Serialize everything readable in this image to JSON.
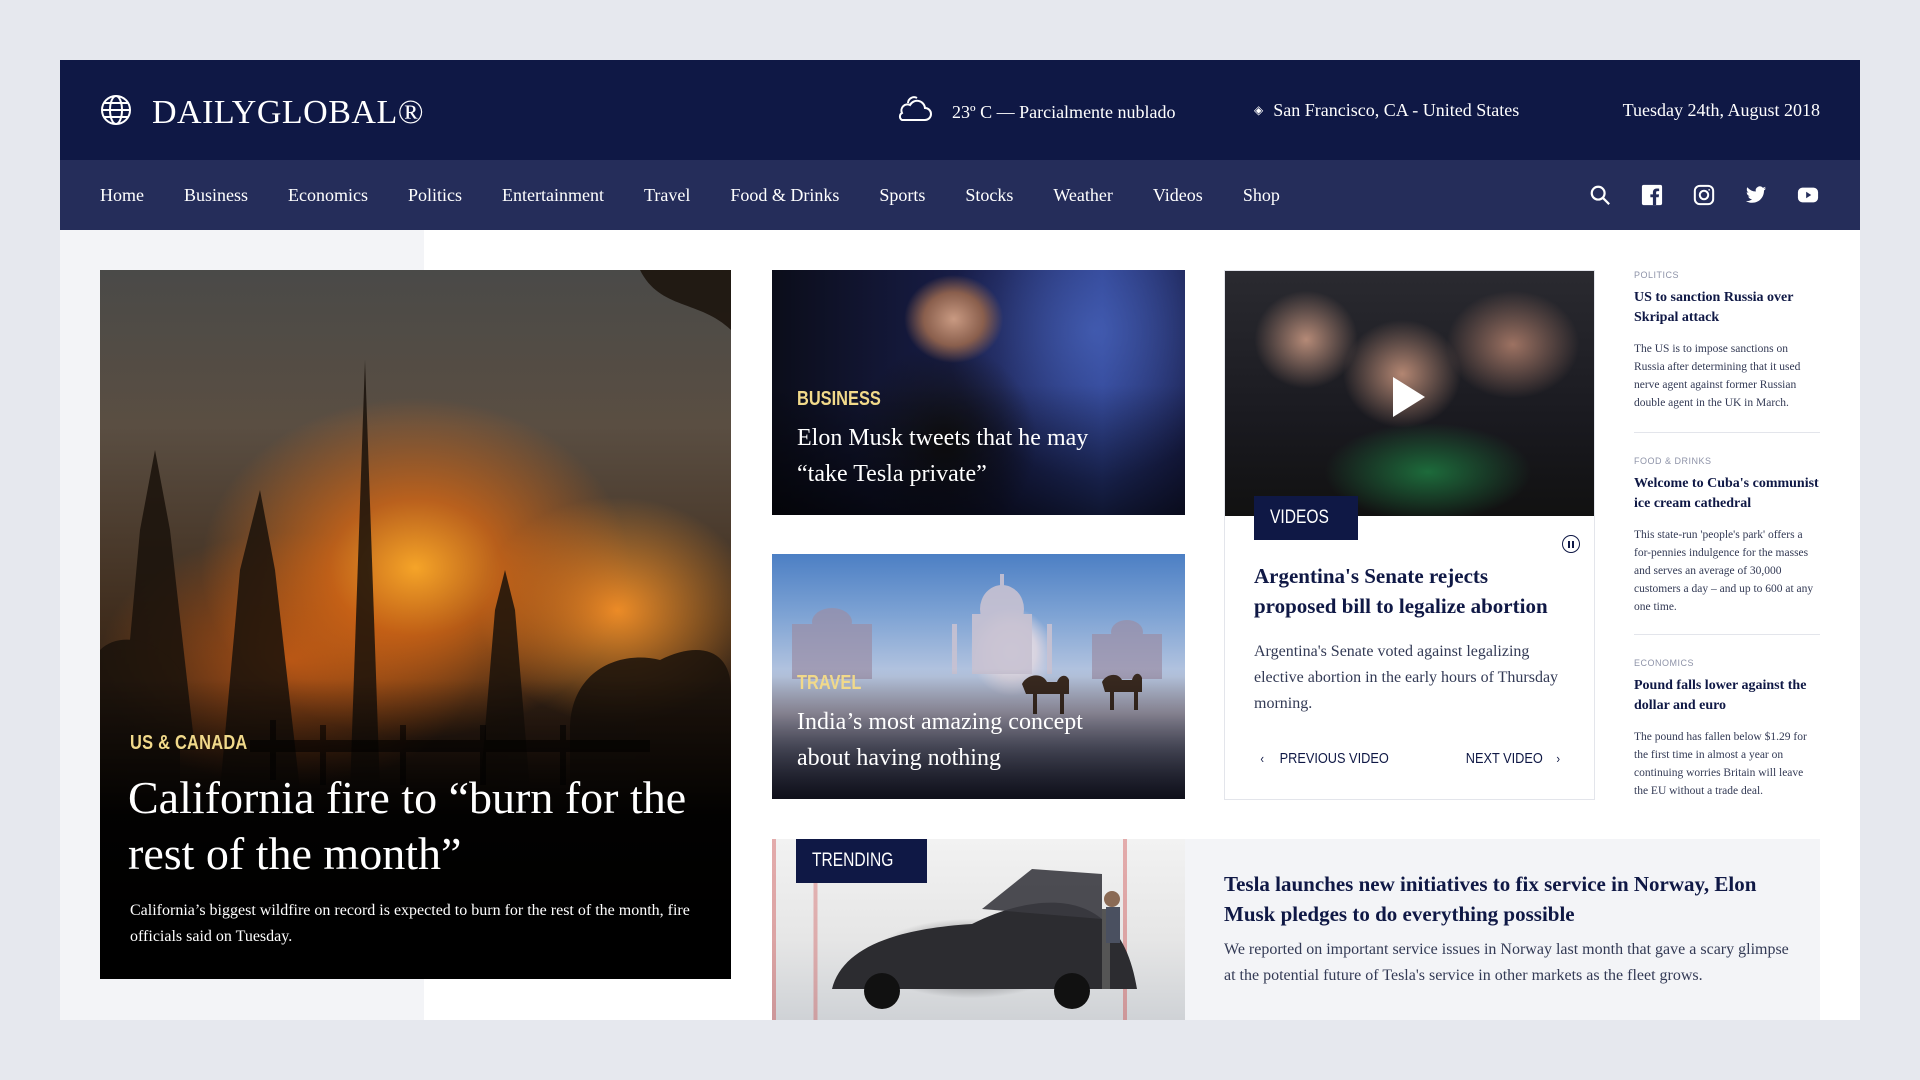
{
  "header": {
    "brand": "DAILYGLOBAL®",
    "weather": "23º C — Parcialmente nublado",
    "location": "San Francisco, CA - United States",
    "date": "Tuesday 24th, August 2018"
  },
  "nav": {
    "items": [
      {
        "label": "Home"
      },
      {
        "label": "Business"
      },
      {
        "label": "Economics"
      },
      {
        "label": "Politics"
      },
      {
        "label": "Entertainment"
      },
      {
        "label": "Travel"
      },
      {
        "label": "Food & Drinks"
      },
      {
        "label": "Sports"
      },
      {
        "label": "Stocks"
      },
      {
        "label": "Weather"
      },
      {
        "label": "Videos"
      },
      {
        "label": "Shop"
      }
    ],
    "icons": [
      "search-icon",
      "facebook-icon",
      "instagram-icon",
      "twitter-icon",
      "youtube-icon"
    ]
  },
  "hero": {
    "category": "US & CANADA",
    "title": "California fire to “burn for the rest of the month”",
    "description": "California’s biggest wildfire on record is expected to burn for the rest of the month, fire officials said on Tuesday."
  },
  "cards": [
    {
      "category": "BUSINESS",
      "title": "Elon Musk tweets that he may “take Tesla private”"
    },
    {
      "category": "TRAVEL",
      "title": "India’s most amazing concept about having nothing"
    }
  ],
  "video": {
    "badge": "VIDEOS",
    "title": "Argentina's Senate rejects proposed bill to legalize abortion",
    "description": "Argentina's Senate voted against legalizing elective abortion in the early hours of Thursday morning.",
    "prev_label": "PREVIOUS VIDEO",
    "next_label": "NEXT VIDEO"
  },
  "sidebar": {
    "items": [
      {
        "category": "POLITICS",
        "title": "US to sanction Russia over Skripal attack",
        "description": "The US is to impose sanctions on Russia after determining that it used nerve agent against former Russian double agent in the UK in March."
      },
      {
        "category": "FOOD & DRINKS",
        "title": "Welcome to Cuba's communist ice cream cathedral",
        "description": "This state-run 'people's park' offers a for-pennies indulgence for the masses and serves an average of 30,000 customers a day – and up to 600 at any one time."
      },
      {
        "category": "ECONOMICS",
        "title": "Pound falls lower against the dollar and euro",
        "description": "The pound has fallen below $1.29 for the first time in almost a year on continuing worries Britain will leave the EU without a trade deal."
      }
    ]
  },
  "trending": {
    "badge": "TRENDING",
    "title": "Tesla launches new initiatives to fix service in Norway, Elon Musk pledges to do everything possible",
    "description": "We reported on important service issues in Norway last month that gave a scary glimpse at the potential future of Tesla's service in other markets as the fleet grows."
  },
  "colors": {
    "header_bg": "#0f1845",
    "nav_bg": "#252d5a",
    "accent_category": "#f1d98a",
    "text_dark": "#0f1845"
  }
}
